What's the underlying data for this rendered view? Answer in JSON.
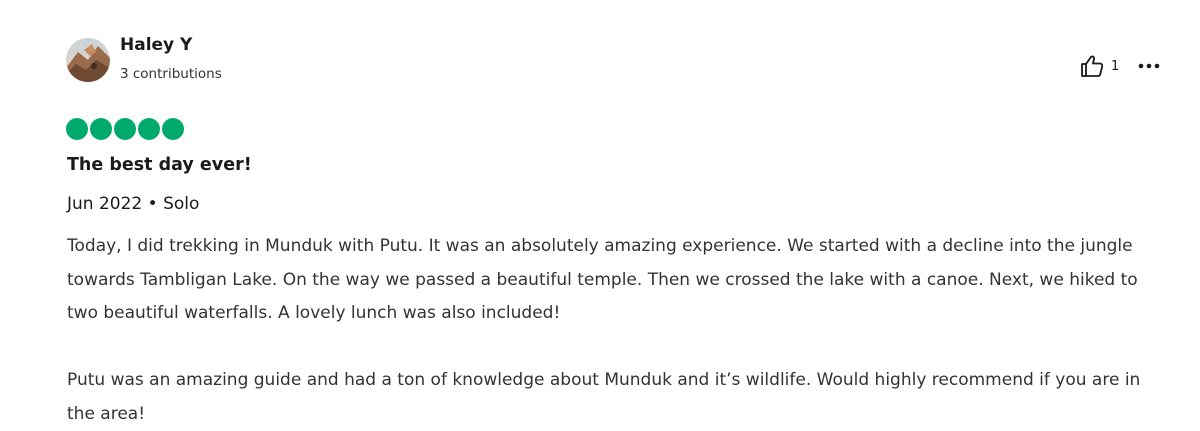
{
  "user": {
    "name": "Haley Y",
    "contributions": "3 contributions"
  },
  "actions": {
    "helpful_icon": "thumbs-up-icon",
    "helpful_count": "1",
    "more_icon": "ellipsis-icon"
  },
  "rating": {
    "value": 5,
    "max": 5,
    "color": "#00aa6c"
  },
  "review": {
    "title": "The best day ever!",
    "meta": "Jun 2022 • Solo",
    "paragraphs": [
      "Today, I did trekking in Munduk with Putu. It was an absolutely amazing experience. We started with a decline into the jungle towards Tambligan Lake. On the way we passed a beautiful temple. Then we crossed the lake with a canoe. Next, we hiked to two beautiful waterfalls. A lovely lunch was also included!",
      "Putu was an amazing guide and had a ton of knowledge about Munduk and it’s wildlife. Would highly recommend if you are in the area!"
    ]
  }
}
